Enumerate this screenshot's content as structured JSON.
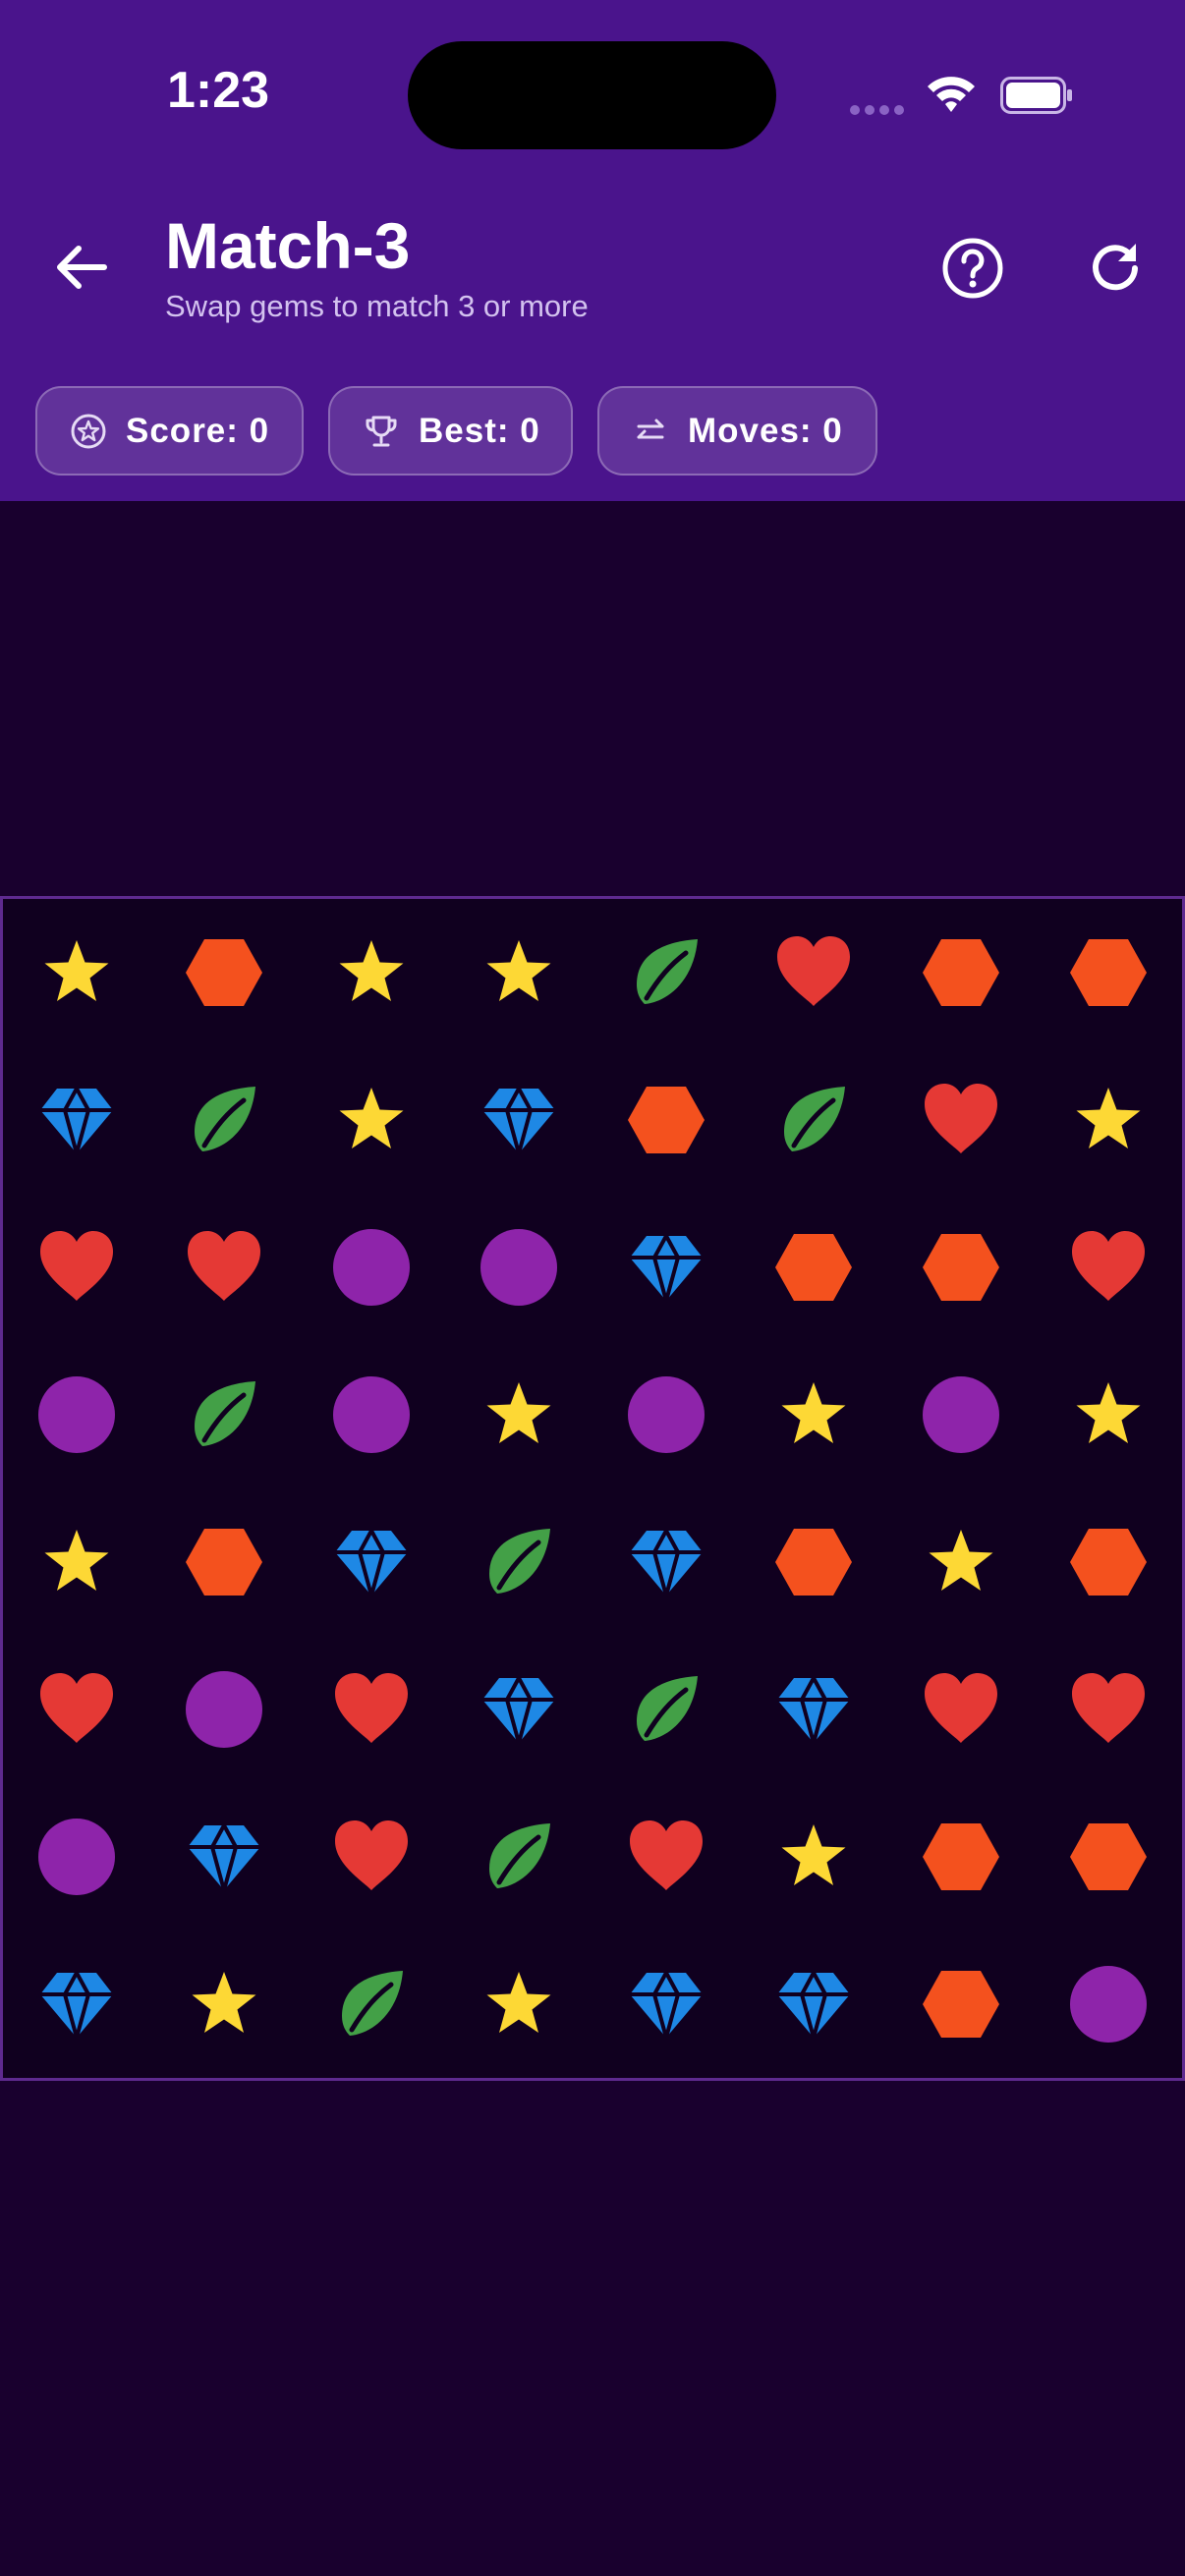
{
  "status": {
    "time": "1:23"
  },
  "header": {
    "title": "Match-3",
    "subtitle": "Swap gems to match 3 or more"
  },
  "stats": {
    "score": "Score: 0",
    "best": "Best: 0",
    "moves": "Moves: 0"
  },
  "colors": {
    "header": "#4a148c",
    "background": "#19002e",
    "star": "#fdd835",
    "hexagon": "#f4511e",
    "leaf": "#43a047",
    "heart": "#e53935",
    "diamond": "#1e88e5",
    "circle": "#8e24aa"
  },
  "board": {
    "rows": [
      [
        "star",
        "hexagon",
        "star",
        "star",
        "leaf",
        "heart",
        "hexagon",
        "hexagon"
      ],
      [
        "diamond",
        "leaf",
        "star",
        "diamond",
        "hexagon",
        "leaf",
        "heart",
        "star"
      ],
      [
        "heart",
        "heart",
        "circle",
        "circle",
        "diamond",
        "hexagon",
        "hexagon",
        "heart"
      ],
      [
        "circle",
        "leaf",
        "circle",
        "star",
        "circle",
        "star",
        "circle",
        "star"
      ],
      [
        "star",
        "hexagon",
        "diamond",
        "leaf",
        "diamond",
        "hexagon",
        "star",
        "hexagon"
      ],
      [
        "heart",
        "circle",
        "heart",
        "diamond",
        "leaf",
        "diamond",
        "heart",
        "heart"
      ],
      [
        "circle",
        "diamond",
        "heart",
        "leaf",
        "heart",
        "star",
        "hexagon",
        "hexagon"
      ],
      [
        "diamond",
        "star",
        "leaf",
        "star",
        "diamond",
        "diamond",
        "hexagon",
        "circle"
      ]
    ]
  }
}
